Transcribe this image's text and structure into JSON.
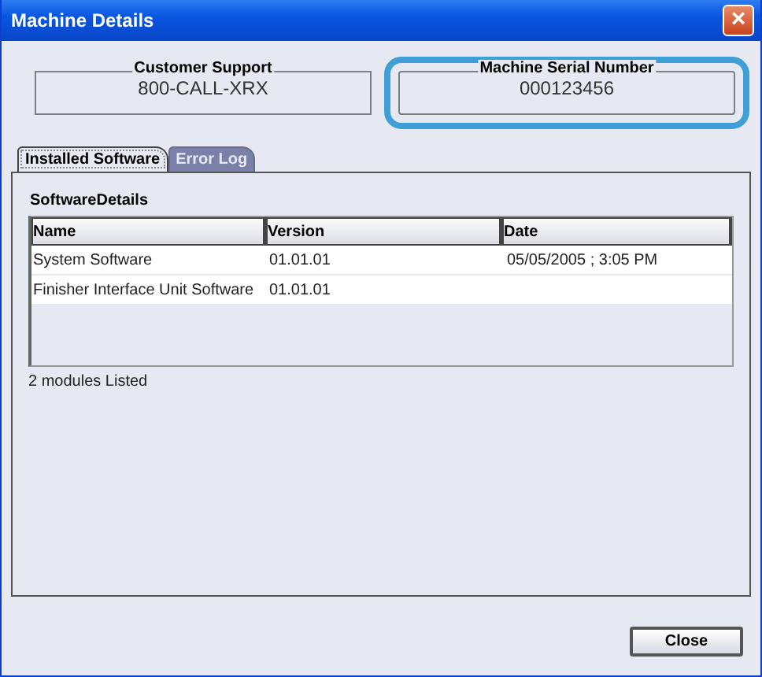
{
  "window": {
    "title": "Machine Details",
    "close_label": "×"
  },
  "info_boxes": [
    {
      "label": "Customer Support",
      "value": "800-CALL-XRX",
      "highlighted": false
    },
    {
      "label": "Machine Serial Number",
      "value": "000123456",
      "highlighted": true
    }
  ],
  "tabs": [
    {
      "label": "Installed Software",
      "selected": true
    },
    {
      "label": "Error Log",
      "selected": false
    }
  ],
  "section_title": "SoftwareDetails",
  "table": {
    "columns": [
      "Name",
      "Version",
      "Date"
    ],
    "rows": [
      [
        "System Software",
        "01.01.01",
        "05/05/2005 ; 3:05 PM"
      ],
      [
        "Finisher Interface Unit Software",
        "01.01.01",
        ""
      ]
    ]
  },
  "status": "2 modules Listed",
  "buttons": [
    "Close"
  ]
}
